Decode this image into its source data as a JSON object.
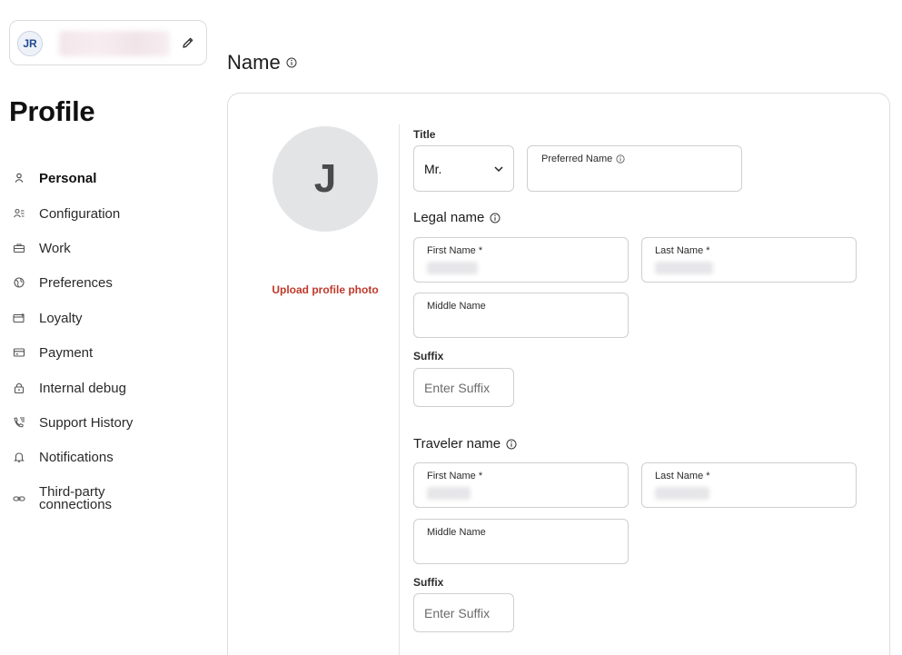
{
  "user": {
    "initials": "JR"
  },
  "sidebar": {
    "title": "Profile",
    "items": [
      {
        "label": "Personal",
        "icon": "person-icon",
        "active": true
      },
      {
        "label": "Configuration",
        "icon": "people-icon"
      },
      {
        "label": "Work",
        "icon": "briefcase-icon"
      },
      {
        "label": "Preferences",
        "icon": "globe-icon"
      },
      {
        "label": "Loyalty",
        "icon": "card-star-icon"
      },
      {
        "label": "Payment",
        "icon": "credit-card-icon"
      },
      {
        "label": "Internal debug",
        "icon": "lock-icon"
      },
      {
        "label": "Support History",
        "icon": "phone-history-icon"
      },
      {
        "label": "Notifications",
        "icon": "bell-icon"
      },
      {
        "label": "Third-party connections",
        "icon": "link-icon"
      }
    ]
  },
  "main": {
    "section_title": "Name",
    "avatar_letter": "J",
    "upload_label": "Upload profile photo",
    "title": {
      "label": "Title",
      "value": "Mr."
    },
    "preferred_name": {
      "label": "Preferred Name"
    },
    "legal": {
      "heading": "Legal name",
      "first_label": "First Name *",
      "last_label": "Last Name *",
      "middle_label": "Middle Name",
      "suffix_label": "Suffix",
      "suffix_placeholder": "Enter Suffix"
    },
    "traveler": {
      "heading": "Traveler name",
      "first_label": "First Name *",
      "last_label": "Last Name *",
      "middle_label": "Middle Name",
      "suffix_label": "Suffix",
      "suffix_placeholder": "Enter Suffix"
    }
  },
  "colors": {
    "accent": "#c0392b",
    "avatar_bg": "#e3e4e6",
    "border": "#cfcfcf"
  }
}
